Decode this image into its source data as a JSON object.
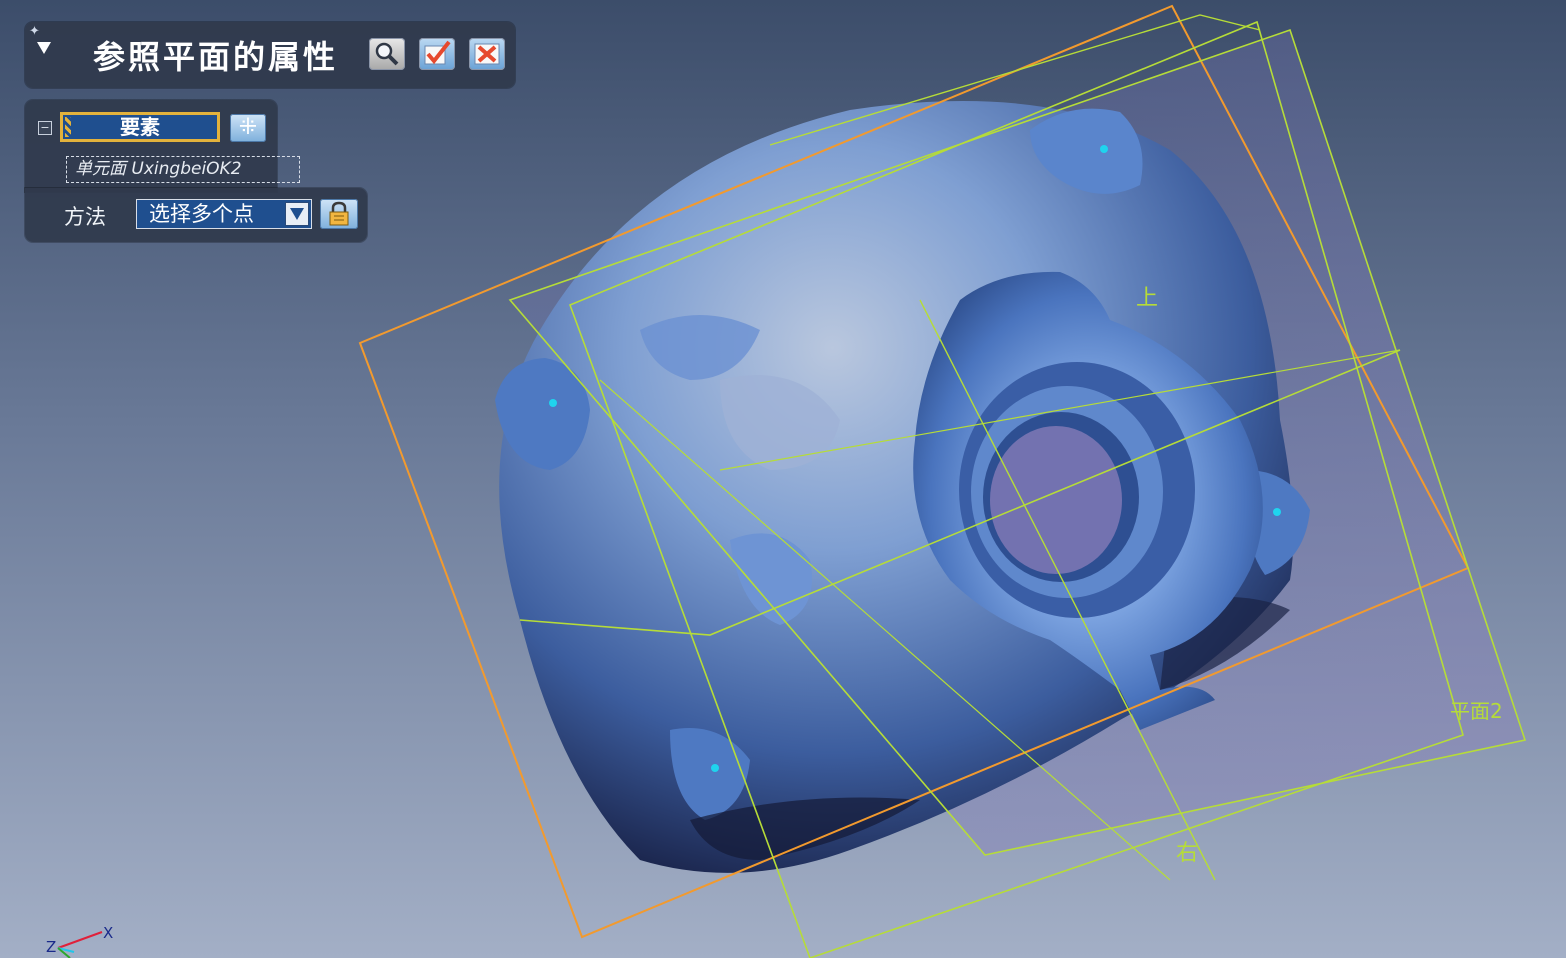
{
  "title_panel": {
    "title": "参照平面的属性",
    "icons": {
      "pin": "pin-icon",
      "collapse": "triangle-down-icon",
      "preview": "magnifier-icon",
      "ok": "checkmark-icon",
      "cancel": "close-x-icon"
    }
  },
  "properties": {
    "element_button_label": "要素",
    "element_value": "单元面 UxingbeiOK2",
    "method_label": "方法",
    "method_value": "选择多个点",
    "icons": {
      "tree_toggle": "minus-box-icon",
      "select_all": "select-all-icon",
      "dropdown": "dropdown-arrow-icon",
      "lock": "lock-icon"
    }
  },
  "viewport": {
    "plane_labels": {
      "top": "上",
      "right": "右",
      "plane2": "平面2"
    },
    "axis_labels": {
      "x": "X",
      "z": "Z"
    },
    "colors": {
      "plane_orange": "#f29a2e",
      "plane_green": "#b6dc38",
      "mesh": "#5b86cc",
      "point": "#1fd4ee"
    }
  }
}
